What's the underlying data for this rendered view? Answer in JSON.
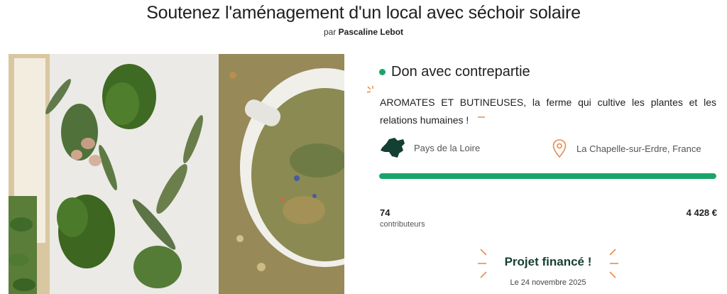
{
  "header": {
    "title": "Soutenez l'aménagement d'un local avec séchoir solaire",
    "by_prefix": "par",
    "author": "Pascaline Lebot"
  },
  "project": {
    "mode_label": "Don avec contrepartie",
    "description": "AROMATES ET BUTINEUSES, la ferme qui cultive les plantes et les relations humaines !",
    "region": "Pays de la Loire",
    "city": "La Chapelle-sur-Erdre, France",
    "progress_fraction": 1.0,
    "contributors_count": "74",
    "contributors_label": "contributeurs",
    "amount": "4 428 €",
    "funded_label": "Projet financé !",
    "funded_date": "Le 24 novembre 2025"
  },
  "colors": {
    "accent_green": "#1aa46a",
    "dark_green": "#143f33",
    "orange_accent": "#e98a4d"
  },
  "icons": {
    "region": "region-map-icon",
    "location": "location-pin-icon"
  }
}
